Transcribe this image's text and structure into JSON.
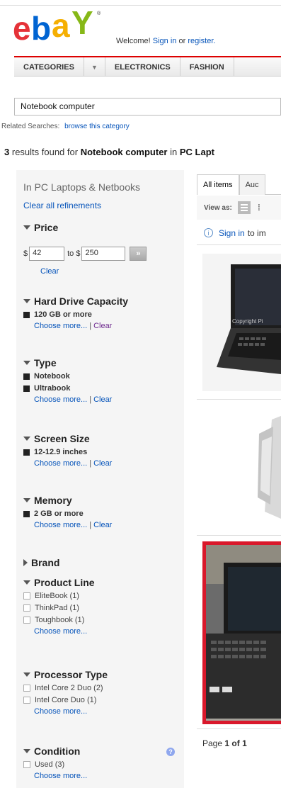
{
  "header": {
    "logo_alt": "ebay",
    "welcome_prefix": "Welcome!",
    "sign_in": "Sign in",
    "or": "or",
    "register": "register."
  },
  "nav": {
    "categories": "CATEGORIES",
    "electronics": "ELECTRONICS",
    "fashion": "FASHION"
  },
  "search": {
    "value": "Notebook computer"
  },
  "related": {
    "label": "Related Searches:",
    "link": "browse this category"
  },
  "results": {
    "count": "3",
    "text1": "results found for",
    "query": "Notebook computer",
    "text2": "in",
    "category": "PC Lapt"
  },
  "sidebar": {
    "title": "In PC Laptops & Netbooks",
    "clear_all": "Clear all refinements",
    "price": {
      "heading": "Price",
      "currency": "$",
      "min": "42",
      "to": "to $",
      "max": "250",
      "go": "»",
      "clear": "Clear"
    },
    "hdd": {
      "heading": "Hard Drive Capacity",
      "selected": "120 GB or more",
      "choose": "Choose more...",
      "sep": "|",
      "clear": "Clear"
    },
    "type": {
      "heading": "Type",
      "selected1": "Notebook",
      "selected2": "Ultrabook",
      "choose": "Choose more...",
      "sep": "|",
      "clear": "Clear"
    },
    "screen": {
      "heading": "Screen Size",
      "selected": "12-12.9 inches",
      "choose": "Choose more...",
      "sep": "|",
      "clear": "Clear"
    },
    "memory": {
      "heading": "Memory",
      "selected": "2 GB or more",
      "choose": "Choose more...",
      "sep": "|",
      "clear": "Clear"
    },
    "brand": {
      "heading": "Brand"
    },
    "product_line": {
      "heading": "Product Line",
      "items": [
        "EliteBook (1)",
        "ThinkPad (1)",
        "Toughbook (1)"
      ],
      "choose": "Choose more..."
    },
    "processor": {
      "heading": "Processor Type",
      "items": [
        "Intel Core 2 Duo (2)",
        "Intel Core Duo (1)"
      ],
      "choose": "Choose more..."
    },
    "condition": {
      "heading": "Condition",
      "items": [
        "Used (3)"
      ],
      "choose": "Choose more...",
      "help": "?"
    }
  },
  "main": {
    "tab_all": "All items",
    "tab_auc": "Auc",
    "view_as": "View as:",
    "signin_link": "Sign in",
    "signin_text": "to im",
    "watermark": "Copyright Pi",
    "page_prefix": "Page",
    "page_current": "1",
    "page_of": "of",
    "page_total": "1"
  },
  "colors": {
    "link": "#0654ba",
    "nav_red": "#dd0000",
    "sidebar_bg": "#f5f5f5",
    "highlight_border": "#d9182b"
  }
}
